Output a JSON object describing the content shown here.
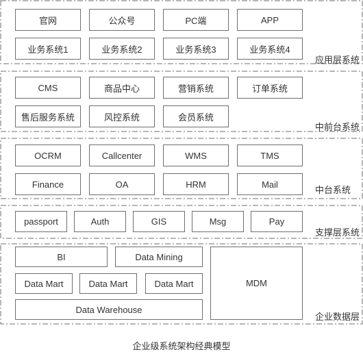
{
  "diagram_title": "企业级系统架构经典模型",
  "colors": {
    "border": "#6e6e6e",
    "text": "#333333",
    "background": "#ffffff"
  },
  "layers": [
    {
      "name": "应用层系统",
      "rows": [
        [
          "官网",
          "公众号",
          "PC端",
          "APP"
        ],
        [
          "业务系统1",
          "业务系统2",
          "业务系统3",
          "业务系统4"
        ]
      ]
    },
    {
      "name": "中前台系统",
      "rows": [
        [
          "CMS",
          "商品中心",
          "营销系统",
          "订单系统"
        ],
        [
          "售后服务系统",
          "风控系统",
          "会员系统"
        ]
      ]
    },
    {
      "name": "中台系统",
      "rows": [
        [
          "OCRM",
          "Callcenter",
          "WMS",
          "TMS"
        ],
        [
          "Finance",
          "OA",
          "HRM",
          "Mail"
        ]
      ]
    },
    {
      "name": "支撑层系统",
      "rows": [
        [
          "passport",
          "Auth",
          "GIS",
          "Msg",
          "Pay"
        ]
      ]
    },
    {
      "name": "企业数据层",
      "items": {
        "bi": "BI",
        "data_mining": "Data Mining",
        "data_marts": [
          "Data Mart",
          "Data Mart",
          "Data Mart"
        ],
        "data_warehouse": "Data Warehouse",
        "mdm": "MDM"
      }
    }
  ]
}
